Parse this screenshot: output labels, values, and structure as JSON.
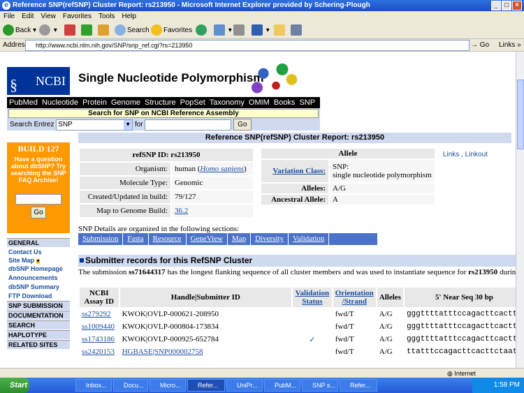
{
  "window": {
    "title": "Reference SNP(refSNP) Cluster Report: rs213950 - Microsoft Internet Explorer provided by Schering-Plough",
    "controls": [
      "_",
      "□",
      "×"
    ]
  },
  "menu": [
    "File",
    "Edit",
    "View",
    "Favorites",
    "Tools",
    "Help"
  ],
  "toolbar": {
    "back": "Back",
    "search": "Search",
    "favorites": "Favorites"
  },
  "address": {
    "label": "Address",
    "url": "http://www.ncbi.nlm.nih.gov/SNP/snp_ref.cgi?rs=213950",
    "go": "Go",
    "links": "Links"
  },
  "page": {
    "logo_text": "NCBI",
    "title": "Single Nucleotide Polymorphism",
    "nav": [
      "PubMed",
      "Nucleotide",
      "Protein",
      "Genome",
      "Structure",
      "PopSet",
      "Taxonomy",
      "OMIM",
      "Books",
      "SNP"
    ],
    "search_header": "Search for SNP on NCBI Reference Assembly",
    "search_label": "Search Entrez",
    "search_db": "SNP",
    "search_for": "for",
    "search_go": "Go",
    "report_title": "Reference SNP(refSNP) Cluster Report: rs213950"
  },
  "sidebar": {
    "build": "BUILD 127",
    "question": "Have a question about dbSNP? Try searching the SNP FAQ Archive!",
    "go": "Go",
    "general": "GENERAL",
    "links": [
      "Contact Us",
      "Site Map",
      "dbSNP Homepage",
      "Announcements",
      "dbSNP Summary",
      "FTP Download"
    ],
    "sections": [
      "SNP SUBMISSION",
      "DOCUMENTATION",
      "SEARCH",
      "HAPLOTYPE",
      "RELATED SITES"
    ]
  },
  "info": {
    "refsnp_id": "refSNP ID: rs213950",
    "organism_label": "Organism:",
    "organism_value": "human (",
    "organism_link": "Homo sapiens",
    "organism_close": ")",
    "moltype_label": "Molecule Type:",
    "moltype_value": "Genomic",
    "created_label": "Created/Updated in build:",
    "created_value": "79/127",
    "map_label": "Map to Genome Build:",
    "map_value": "36.2"
  },
  "allele": {
    "header": "Allele",
    "variation_label": "Variation Class:",
    "variation_value": "SNP:",
    "variation_value2": "single nucleotide polymorphism",
    "alleles_label": "Alleles:",
    "alleles_value": "A/G",
    "ancestral_label": "Ancestral Allele:",
    "ancestral_value": "A"
  },
  "links_area": "Links , Linkout",
  "details_text": "SNP Details are organized in the following sections:",
  "sections": [
    "Submission",
    "Fasta",
    "Resource",
    "GeneView",
    "Map",
    "Diversity",
    "Validation"
  ],
  "submitter": {
    "header": "Submitter records for this RefSNP Cluster",
    "text_pre": "The submission ",
    "text_ss": "ss71644317",
    "text_mid": " has the longest flanking sequence of all cluster members and was used to instantiate sequence for ",
    "text_rs": "rs213950",
    "text_post": " durin",
    "columns": [
      "NCBI Assay ID",
      "Handle|Submitter ID",
      "Validation Status",
      "Orientation /Strand",
      "Alleles",
      "5' Near Seq 30 bp"
    ],
    "rows": [
      {
        "id": "ss279292",
        "handle": "KWOK|OVLP-000621-208950",
        "valid": "",
        "orient": "fwd/T",
        "alleles": "A/G",
        "seq": "gggttttatttccagacttcactto"
      },
      {
        "id": "ss1009440",
        "handle": "KWOK|OVLP-000804-173834",
        "valid": "",
        "orient": "fwd/T",
        "alleles": "A/G",
        "seq": "gggttttatttccagacttcactto"
      },
      {
        "id": "ss1743186",
        "handle": "KWOK|OVLP-000925-652784",
        "valid": "✓",
        "orient": "fwd/T",
        "alleles": "A/G",
        "seq": "gggttttatttccagacttcactto"
      },
      {
        "id": "ss2420153",
        "handle": "HGBASE|SNP000002758",
        "valid": "",
        "orient": "fwd/T",
        "alleles": "A/G",
        "seq": "ttatttccagacttcacttctaatg"
      }
    ]
  },
  "status": {
    "text": "",
    "zone": "Internet"
  },
  "taskbar": {
    "start": "Start",
    "tasks": [
      "Inbox...",
      "Docu...",
      "Micro...",
      "Refer...",
      "UniPr...",
      "PubM...",
      "SNP s...",
      "Refer..."
    ],
    "clock": "1:58 PM"
  }
}
